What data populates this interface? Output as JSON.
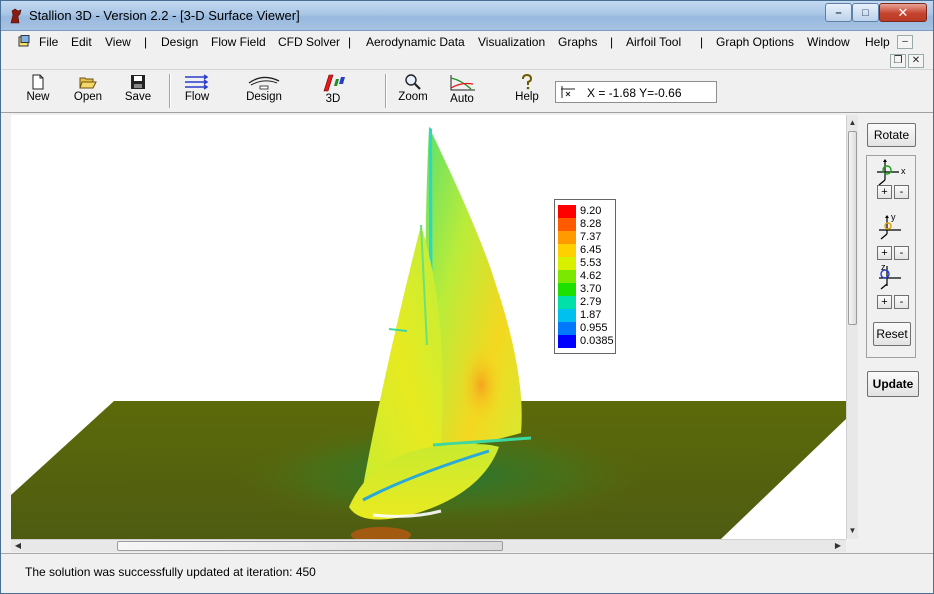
{
  "window": {
    "title": "Stallion 3D - Version 2.2 - [3-D Surface Viewer]",
    "minimize_label": "–",
    "maximize_label": "□",
    "close_label": "✕"
  },
  "menu": {
    "items": [
      "File",
      "Edit",
      "View",
      "Design",
      "Flow Field",
      "CFD Solver",
      "Aerodynamic Data",
      "Visualization",
      "Graphs",
      "Airfoil Tool",
      "Graph Options",
      "Window",
      "Help"
    ],
    "separator": "|",
    "mdi_minimize": "–",
    "mdi_restore": "❐",
    "mdi_close": "✕"
  },
  "toolbar": {
    "new_label": "New",
    "open_label": "Open",
    "save_label": "Save",
    "flow_label": "Flow",
    "design_label": "Design",
    "view3d_label": "3D",
    "zoom_label": "Zoom",
    "auto_label": "Auto",
    "help_label": "Help",
    "coordinates": "X = -1.68  Y=-0.66"
  },
  "legend": {
    "labels": [
      "9.20",
      "8.28",
      "7.37",
      "6.45",
      "5.53",
      "4.62",
      "3.70",
      "2.79",
      "1.87",
      "0.955",
      "0.0385"
    ],
    "colors": [
      "#ff0000",
      "#ff5a00",
      "#ff9a00",
      "#ffd000",
      "#d8f000",
      "#7ae800",
      "#1ee000",
      "#00e0a8",
      "#00c0f0",
      "#0078ff",
      "#0000ff"
    ]
  },
  "side_panel": {
    "rotate_label": "Rotate",
    "axis_x_label": "x",
    "axis_y_label": "y",
    "axis_z_label": "z",
    "plus_label": "+",
    "minus_label": "-",
    "reset_label": "Reset",
    "update_label": "Update"
  },
  "status": {
    "message": "The solution was successfully updated at iteration: 450"
  },
  "colors": {
    "ground": "#5f6a0a",
    "titlebar": "#a9c6e6"
  }
}
